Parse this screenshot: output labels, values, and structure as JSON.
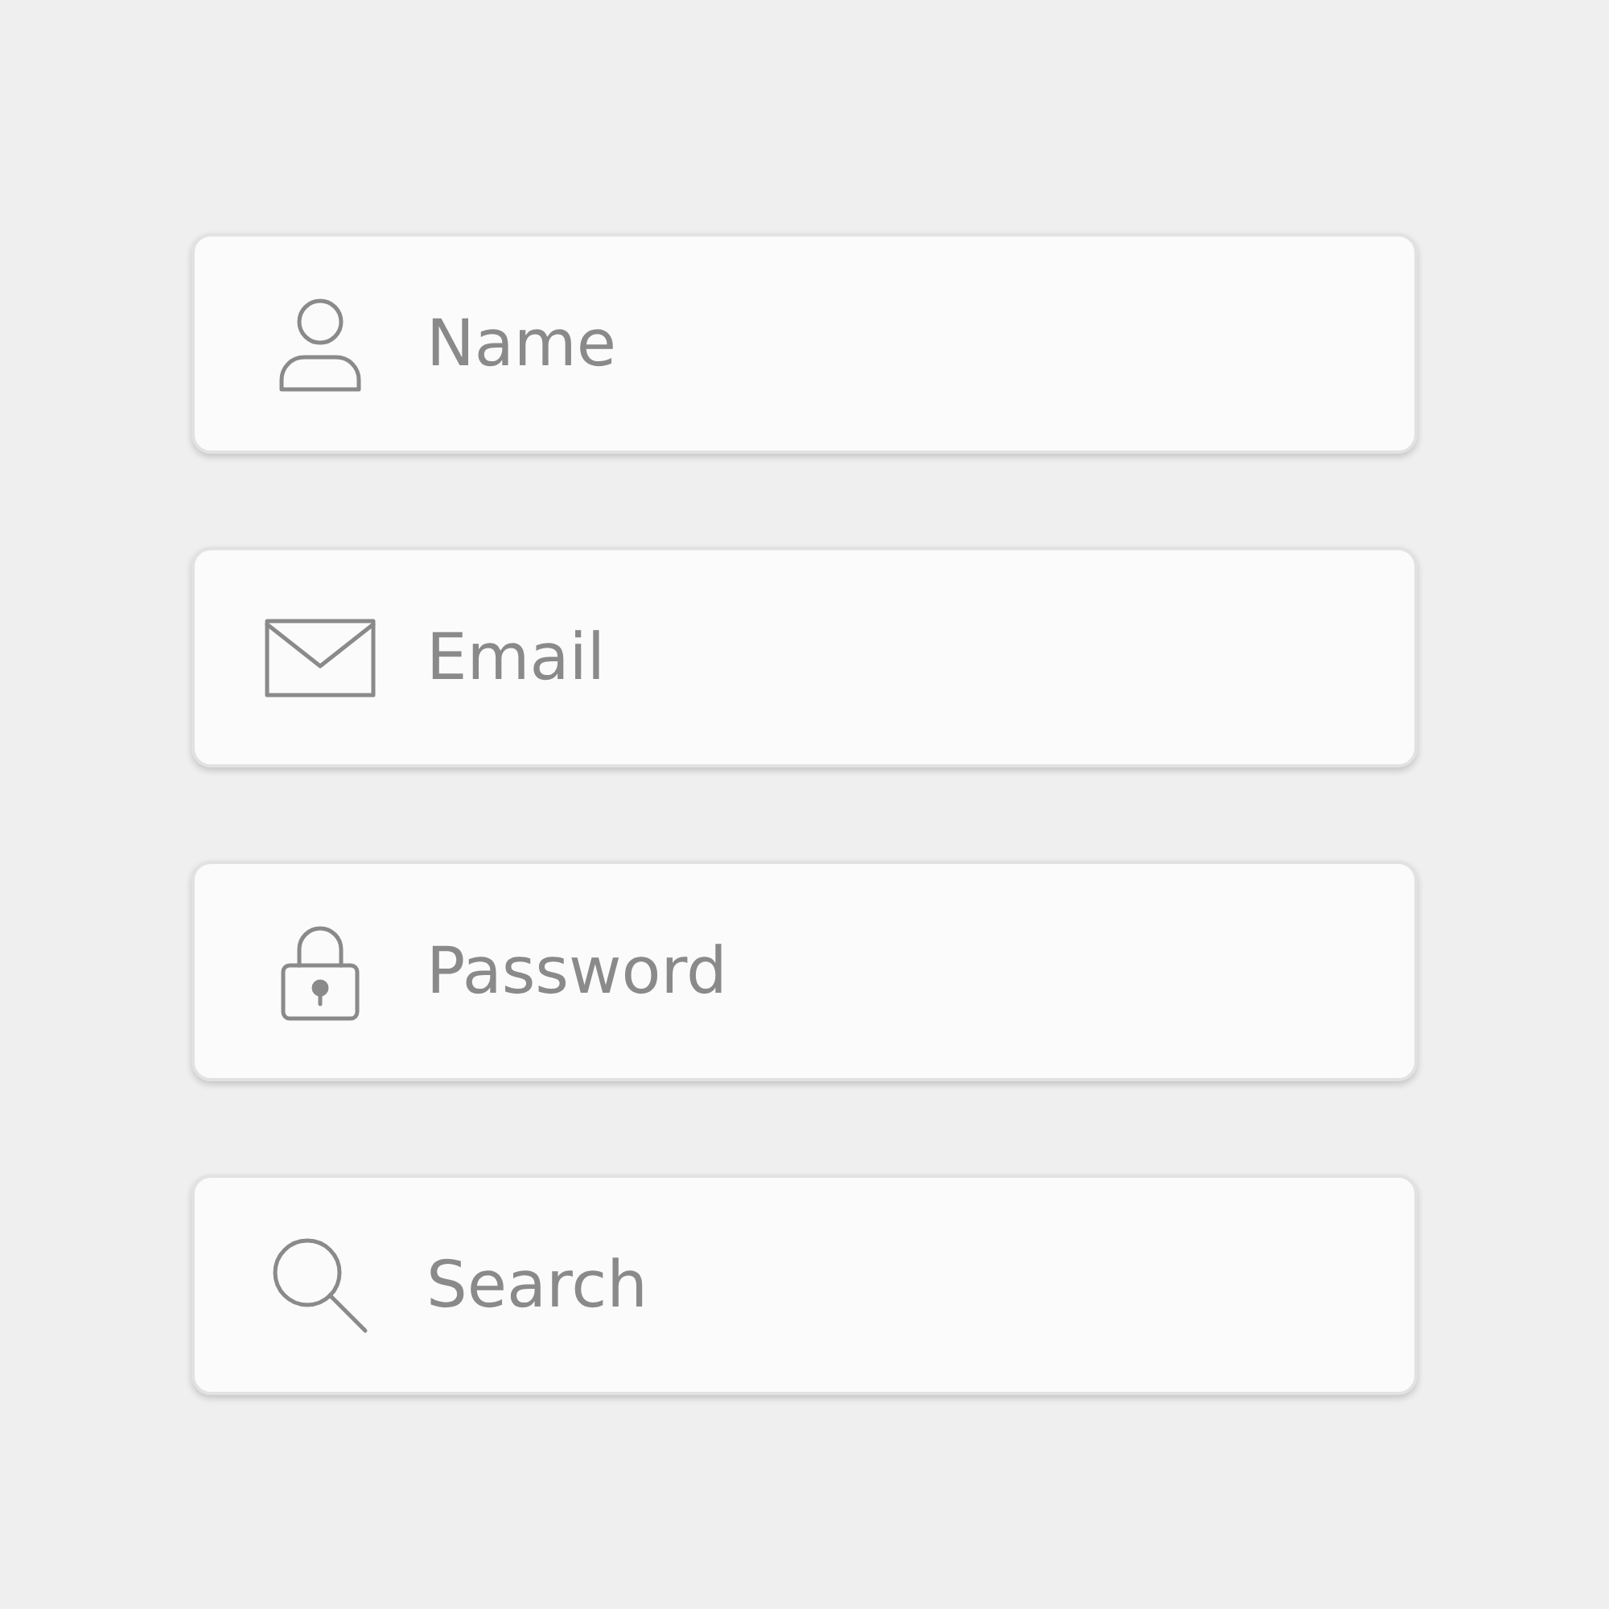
{
  "fields": [
    {
      "kind": "person",
      "placeholder": "Name"
    },
    {
      "kind": "mail",
      "placeholder": "Email"
    },
    {
      "kind": "lock",
      "placeholder": "Password"
    },
    {
      "kind": "search",
      "placeholder": "Search"
    }
  ]
}
